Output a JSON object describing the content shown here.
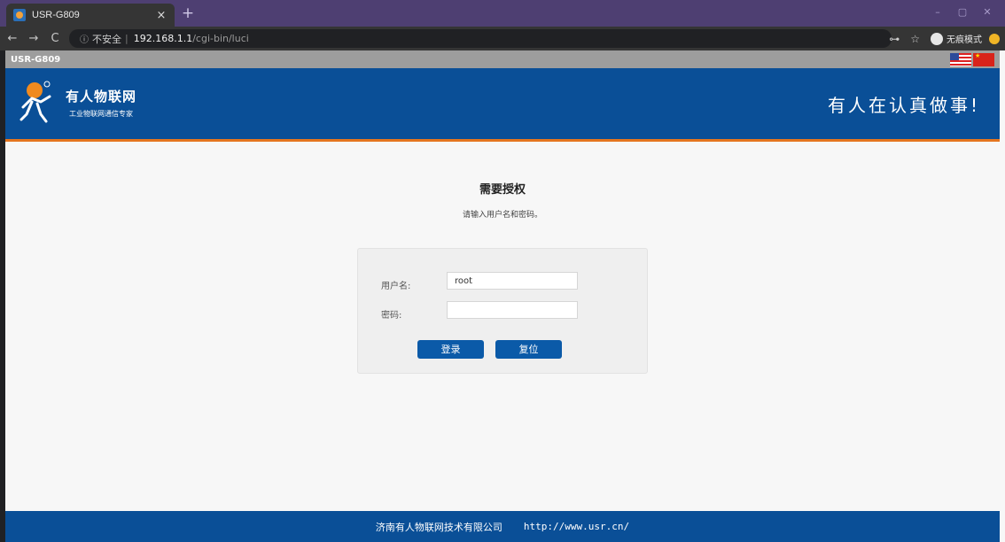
{
  "browser": {
    "tab_title": "USR-G809",
    "tab_close": "×",
    "new_tab": "+",
    "window_controls": [
      "–",
      "▢",
      "✕"
    ],
    "nav": {
      "back": "←",
      "forward": "→",
      "reload": "C"
    },
    "address": {
      "info_icon": "ⓘ",
      "security_label": "不安全",
      "separator": "|",
      "host": "192.168.1.1",
      "path": "/cgi-bin/luci"
    },
    "key_icon": "⊶",
    "star_icon": "☆",
    "incognito_label": "无痕模式"
  },
  "device": {
    "name": "USR-G809"
  },
  "banner": {
    "brand_name": "有人物联网",
    "brand_sub": "工业物联网通信专家",
    "slogan": "有人在认真做事!",
    "accent_color": "#0a4f97",
    "stripe_color": "#e5761f"
  },
  "auth": {
    "title": "需要授权",
    "message": "请输入用户名和密码。",
    "username_label": "用户名:",
    "username_value": "root",
    "password_label": "密码:",
    "password_value": "",
    "login_button": "登录",
    "reset_button": "复位"
  },
  "footer": {
    "company": "济南有人物联网技术有限公司",
    "url": "http://www.usr.cn/"
  }
}
